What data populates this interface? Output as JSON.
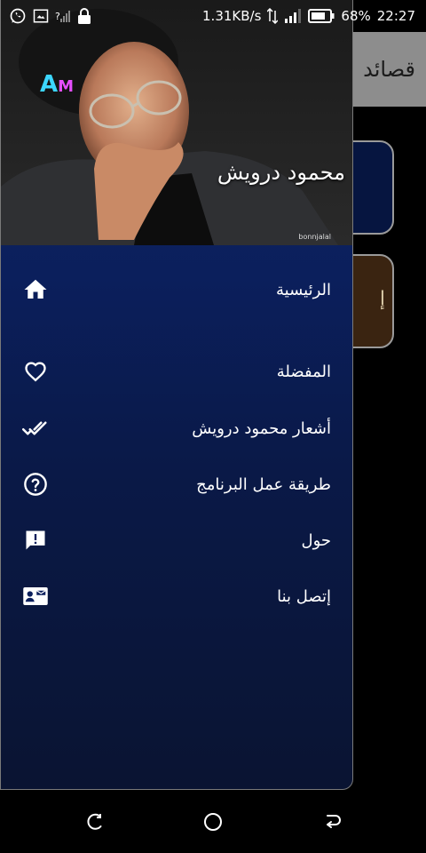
{
  "status_bar": {
    "network_speed": "1.31KB/s",
    "battery_percent": "68%",
    "time": "22:27",
    "signal_unknown_mark": "?"
  },
  "background_app": {
    "title": "قصائد",
    "card_text": "إ"
  },
  "drawer": {
    "header_name": "محمود درويش",
    "watermark": "bonnjalal",
    "logo_letters": {
      "a": "A",
      "m": "M"
    },
    "items": [
      {
        "label": "الرئيسية",
        "icon": "home-icon"
      },
      {
        "label": "المفضلة",
        "icon": "heart-icon"
      },
      {
        "label": "أشعار محمود درويش",
        "icon": "double-check-icon"
      },
      {
        "label": "طريقة عمل البرنامج",
        "icon": "help-circle-icon"
      },
      {
        "label": "حول",
        "icon": "feedback-icon"
      },
      {
        "label": "إتصل بنا",
        "icon": "contact-card-icon"
      }
    ]
  },
  "nav_bar": {
    "buttons": [
      "recent-apps-icon",
      "home-circle-icon",
      "back-icon"
    ]
  },
  "colors": {
    "drawer_top": "#0f2566",
    "drawer_bottom": "#0a1432",
    "header_bg": "#8d8d8d"
  }
}
